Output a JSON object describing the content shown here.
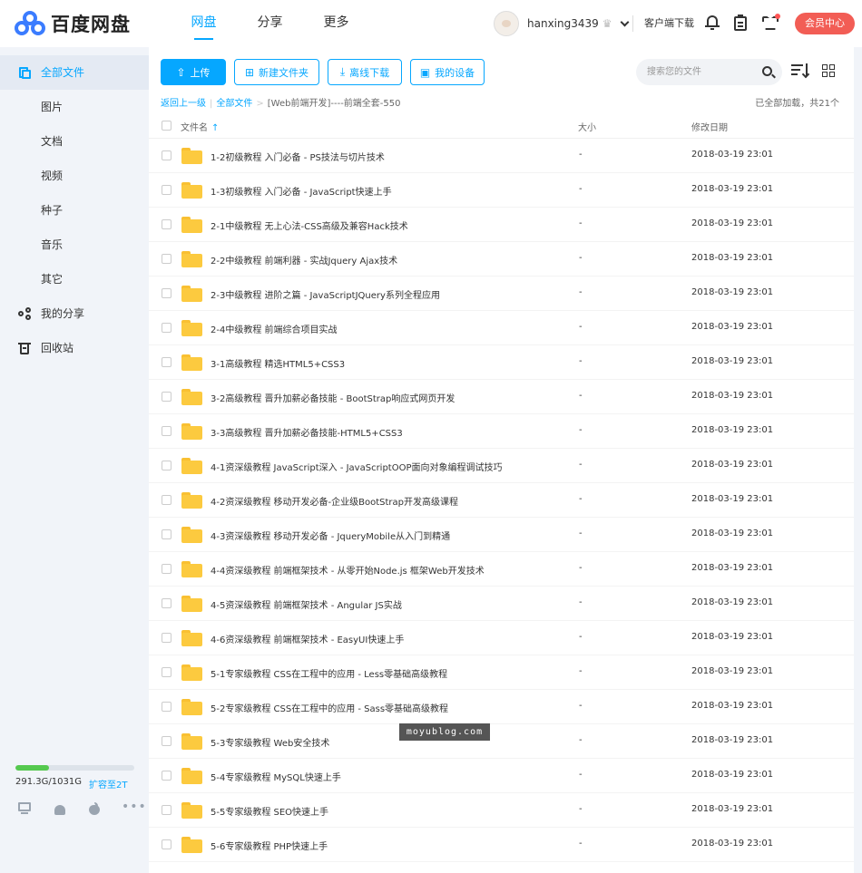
{
  "header": {
    "logo_text": "百度网盘",
    "tabs": [
      {
        "label": "网盘",
        "active": true
      },
      {
        "label": "分享",
        "active": false
      },
      {
        "label": "更多",
        "active": false
      }
    ],
    "username": "hanxing3439",
    "client_download": "客户端下载",
    "vip_button": "会员中心"
  },
  "sidebar": {
    "items": [
      {
        "label": "全部文件",
        "icon": "files-icon",
        "active": true
      },
      {
        "label": "图片"
      },
      {
        "label": "文档"
      },
      {
        "label": "视频"
      },
      {
        "label": "种子"
      },
      {
        "label": "音乐"
      },
      {
        "label": "其它"
      },
      {
        "label": "我的分享",
        "icon": "share-icon"
      },
      {
        "label": "回收站",
        "icon": "trash-icon"
      }
    ],
    "storage": {
      "used_text": "291.3G/1031G",
      "expand_label": "扩容至2T",
      "used_fraction": 0.283,
      "fill_color": "#55c94f"
    }
  },
  "toolbar": {
    "upload_label": "上传",
    "new_folder_label": "新建文件夹",
    "offline_download_label": "离线下载",
    "my_devices_label": "我的设备",
    "search_placeholder": "搜索您的文件"
  },
  "breadcrumb": {
    "back_label": "返回上一级",
    "root_label": "全部文件",
    "current_label": "[Web前端开发]----前端全套-550",
    "loaded_text": "已全部加载，共21个"
  },
  "columns": {
    "name": "文件名",
    "size": "大小",
    "date": "修改日期"
  },
  "files": [
    {
      "name": "1-2初级教程 入门必备 - PS技法与切片技术",
      "size": "-",
      "date": "2018-03-19 23:01"
    },
    {
      "name": "1-3初级教程 入门必备 - JavaScript快速上手",
      "size": "-",
      "date": "2018-03-19 23:01"
    },
    {
      "name": "2-1中级教程 无上心法-CSS高级及兼容Hack技术",
      "size": "-",
      "date": "2018-03-19 23:01"
    },
    {
      "name": "2-2中级教程 前端利器 - 实战Jquery Ajax技术",
      "size": "-",
      "date": "2018-03-19 23:01"
    },
    {
      "name": "2-3中级教程 进阶之篇 - JavaScriptJQuery系列全程应用",
      "size": "-",
      "date": "2018-03-19 23:01"
    },
    {
      "name": "2-4中级教程 前端综合项目实战",
      "size": "-",
      "date": "2018-03-19 23:01"
    },
    {
      "name": "3-1高级教程 精选HTML5+CSS3",
      "size": "-",
      "date": "2018-03-19 23:01"
    },
    {
      "name": "3-2高级教程 晋升加薪必备技能 - BootStrap响应式网页开发",
      "size": "-",
      "date": "2018-03-19 23:01"
    },
    {
      "name": "3-3高级教程 晋升加薪必备技能-HTML5+CSS3",
      "size": "-",
      "date": "2018-03-19 23:01"
    },
    {
      "name": "4-1资深级教程 JavaScript深入 - JavaScriptOOP面向对象编程调试技巧",
      "size": "-",
      "date": "2018-03-19 23:01"
    },
    {
      "name": "4-2资深级教程 移动开发必备-企业级BootStrap开发高级课程",
      "size": "-",
      "date": "2018-03-19 23:01"
    },
    {
      "name": "4-3资深级教程 移动开发必备 - JqueryMobile从入门到精通",
      "size": "-",
      "date": "2018-03-19 23:01"
    },
    {
      "name": "4-4资深级教程 前端框架技术 - 从零开始Node.js 框架Web开发技术",
      "size": "-",
      "date": "2018-03-19 23:01"
    },
    {
      "name": "4-5资深级教程 前端框架技术 - Angular JS实战",
      "size": "-",
      "date": "2018-03-19 23:01"
    },
    {
      "name": "4-6资深级教程 前端框架技术 - EasyUI快速上手",
      "size": "-",
      "date": "2018-03-19 23:01"
    },
    {
      "name": "5-1专家级教程 CSS在工程中的应用 - Less零基础高级教程",
      "size": "-",
      "date": "2018-03-19 23:01"
    },
    {
      "name": "5-2专家级教程 CSS在工程中的应用 - Sass零基础高级教程",
      "size": "-",
      "date": "2018-03-19 23:01"
    },
    {
      "name": "5-3专家级教程 Web安全技术",
      "size": "-",
      "date": "2018-03-19 23:01"
    },
    {
      "name": "5-4专家级教程 MySQL快速上手",
      "size": "-",
      "date": "2018-03-19 23:01"
    },
    {
      "name": "5-5专家级教程 SEO快速上手",
      "size": "-",
      "date": "2018-03-19 23:01"
    },
    {
      "name": "5-6专家级教程 PHP快速上手",
      "size": "-",
      "date": "2018-03-19 23:01"
    }
  ],
  "watermark": "moyublog.com",
  "colors": {
    "accent": "#06a7ff",
    "vip": "#f25d55",
    "folder": "#fcca3f"
  }
}
